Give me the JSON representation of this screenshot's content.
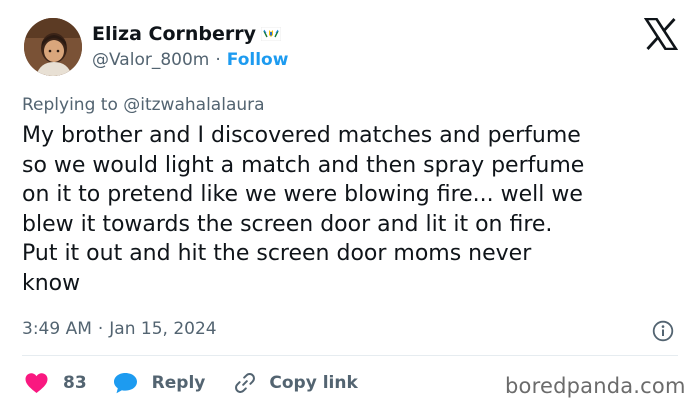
{
  "author": {
    "name": "Eliza Cornberry",
    "handle": "@Valor_800m",
    "follow_label": "Follow",
    "separator": "·"
  },
  "reply_context": {
    "prefix": "Replying to",
    "mention": "@itzwahalalaura"
  },
  "tweet": {
    "text": "My brother and I discovered matches and perfume\nso we would light a match and then spray perfume\non it to pretend like we were blowing fire... well we\nblew it towards the screen door and lit it on fire.\nPut it out and hit the screen door moms never\nknow",
    "time": "3:49 AM",
    "separator": "·",
    "date": "Jan 15, 2024"
  },
  "actions": {
    "like_count": "83",
    "reply_label": "Reply",
    "copy_link_label": "Copy link"
  },
  "watermark": "boredpanda.com",
  "icons": {
    "flag": "virgin-islands-flag-icon",
    "logo": "x-logo-icon",
    "info": "info-icon",
    "like": "heart-icon",
    "reply": "chat-bubble-icon",
    "copy": "link-icon"
  },
  "colors": {
    "text": "#0f1419",
    "secondary": "#536471",
    "accent": "#1d9bf0",
    "like": "#f91880",
    "divider": "#e6ecf0"
  }
}
